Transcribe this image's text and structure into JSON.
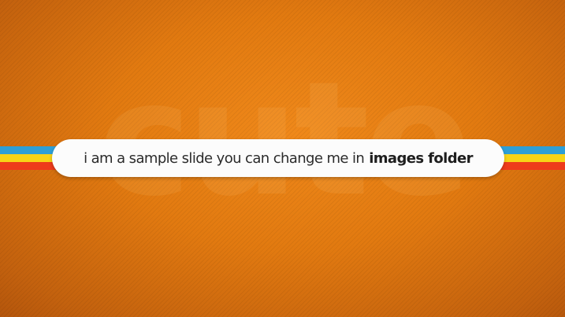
{
  "slide": {
    "watermark_text": "cute",
    "caption_text": "i am a sample slide you can change me in",
    "caption_emphasis": "images folder"
  },
  "colors": {
    "background": "#E27A10",
    "stripe_blue": "#2E9FD6",
    "stripe_yellow": "#F7D417",
    "stripe_red": "#EE3B1B",
    "pill_background": "#FCFCFC"
  }
}
